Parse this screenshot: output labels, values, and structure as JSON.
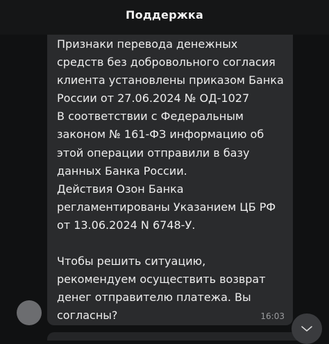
{
  "header": {
    "title": "Поддержка"
  },
  "message": {
    "text": "Признаки перевода денежных\nсредств без добровольного согласия\nклиента установлены приказом Банка\nРоссии от 27.06.2024 № ОД-1027\nВ соответствии с Федеральным\nзаконом № 161-ФЗ информацию об\nэтой операции отправили в базу\nданных Банка России.\nДействия Озон Банка\nрегламентированы Указанием ЦБ РФ\nот 13.06.2024 N 6748-У.\n\nЧтобы решить ситуацию,\nрекомендуем осуществить возврат\nденег отправителю платежа. Вы\nсогласны?",
    "time": "16:03"
  },
  "icons": {
    "scroll_down": "chevron-down-icon"
  },
  "colors": {
    "background": "#101112",
    "bubble": "#2a2b2d",
    "avatar": "#6c6d70"
  }
}
